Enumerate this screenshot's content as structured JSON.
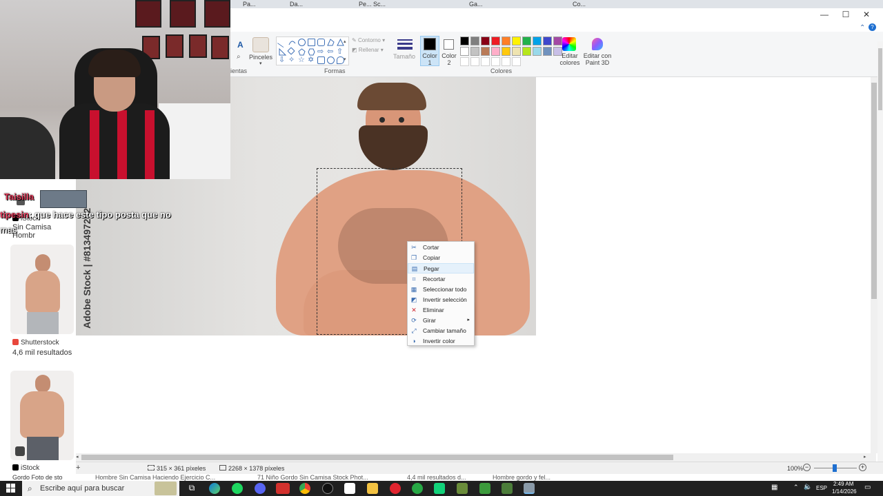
{
  "browser_tabs": {
    "items": [
      "Pa...",
      "Da...",
      "Pe... Sc...",
      "Ga...",
      "Co...",
      "Sc..."
    ]
  },
  "paint": {
    "ribbon": {
      "brushes_label": "Pinceles",
      "tools_label": "ientas",
      "shapes_group_label": "Formas",
      "outline_label": "Contorno",
      "fill_label": "Rellenar",
      "size_label": "Tamaño",
      "color1_label": "Color 1",
      "color2_label": "Color 2",
      "colors_group_label": "Colores",
      "edit_colors_label": "Editar colores",
      "paint3d_label": "Editar con Paint 3D",
      "text_tool": "A"
    },
    "palette_row1": [
      "#000000",
      "#7f7f7f",
      "#880015",
      "#ed1c24",
      "#ff7f27",
      "#fff200",
      "#22b14c",
      "#00a2e8",
      "#3f48cc",
      "#a349a4"
    ],
    "palette_row2": [
      "#ffffff",
      "#c3c3c3",
      "#b97a57",
      "#ffaec9",
      "#ffc90e",
      "#efe4b0",
      "#b5e61d",
      "#99d9ea",
      "#7092be",
      "#c8bfe7"
    ],
    "color1": "#000000",
    "color2": "#ffffff",
    "watermark": "Adobe Stock | #813497262",
    "context_menu": {
      "items": [
        {
          "label": "Cortar",
          "icon": "scissors-icon",
          "glyph": "✂"
        },
        {
          "label": "Copiar",
          "icon": "copy-icon",
          "glyph": "❐"
        },
        {
          "label": "Pegar",
          "icon": "paste-icon",
          "glyph": "▤"
        },
        {
          "label": "Recortar",
          "icon": "crop-icon",
          "glyph": "⌗"
        },
        {
          "label": "Seleccionar todo",
          "icon": "select-all-icon",
          "glyph": "▦"
        },
        {
          "label": "Invertir selección",
          "icon": "invert-selection-icon",
          "glyph": "◩"
        },
        {
          "label": "Eliminar",
          "icon": "delete-icon",
          "glyph": "✕"
        },
        {
          "label": "Girar",
          "icon": "rotate-icon",
          "glyph": "⟳"
        },
        {
          "label": "Cambiar tamaño",
          "icon": "resize-icon",
          "glyph": "⤢"
        },
        {
          "label": "Invertir color",
          "icon": "invert-color-icon",
          "glyph": "◑"
        }
      ],
      "highlighted": "Pegar"
    },
    "status": {
      "selection_size": "315 × 361 píxeles",
      "image_size": "2268 × 1378 píxeles",
      "zoom": "100%"
    }
  },
  "chat": {
    "line1_user": "Taisilla",
    "line2_user": "tipesin",
    "line2_text": ": que hace este tipo posta que no",
    "line2_cont": "mas"
  },
  "left_results": {
    "result1_source": "iStock",
    "result1_title": "Sin Camisa Hombr",
    "result2_source": "Shutterstock",
    "result2_count": "4,6 mil resultados",
    "result3_source": "iStock",
    "result3_title": "Gordo Foto de sto"
  },
  "bottom_captions": [
    "Hombre Sin Camisa Haciendo Ejercicio C...",
    "71 Niño Gordo Sin Camisa Stock Phot...",
    "4,4 mil resultados d...",
    "Hombre gordo y fel..."
  ],
  "taskbar": {
    "search_placeholder": "Escribe aquí para buscar",
    "language": "ESP",
    "time": "2:49 AM",
    "date": "1/14/2026"
  }
}
